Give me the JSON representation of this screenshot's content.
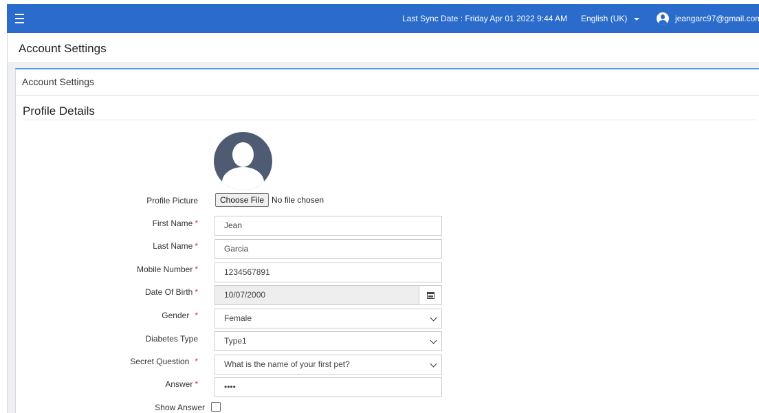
{
  "topbar": {
    "menu_icon": "hamburger-menu-icon",
    "sync_text": "Last Sync Date : Friday Apr 01 2022 9:44 AM",
    "language": "English (UK)",
    "user_email": "jeangarc97@gmail.com",
    "color": "#2a6bcb"
  },
  "page": {
    "title": "Account Settings"
  },
  "card": {
    "title": "Account Settings",
    "accent_color": "#5b9bd5"
  },
  "profile": {
    "section_title": "Profile Details",
    "picture_label": "Profile Picture",
    "choose_file_label": "Choose File",
    "file_status": "No file chosen",
    "first_name_label": "First Name",
    "first_name": "Jean",
    "last_name_label": "Last Name",
    "last_name": "Garcia",
    "mobile_label": "Mobile Number",
    "mobile": "1234567891",
    "dob_label": "Date Of Birth",
    "dob": "10/07/2000",
    "gender_label": "Gender",
    "gender": "Female",
    "diabetes_label": "Diabetes Type",
    "diabetes": "Type1",
    "secret_label": "Secret Question",
    "secret_question": "What is the name of your first pet?",
    "answer_label": "Answer",
    "answer": "••••",
    "show_answer_label": "Show Answer",
    "show_answer_checked": false,
    "required_mark": "*",
    "required_color": "#d9342b"
  }
}
